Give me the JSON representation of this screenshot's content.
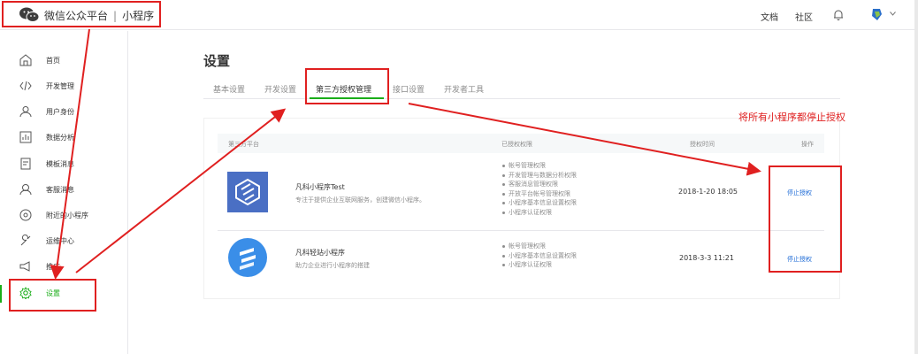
{
  "header": {
    "brand": "微信公众平台",
    "separator": "|",
    "product": "小程序",
    "links": [
      "文档",
      "社区"
    ],
    "icons": {
      "logo": "wechat-logo-icon",
      "bell": "bell-icon",
      "avatar": "avatar",
      "caret": "chevron-down-icon"
    }
  },
  "sidebar": {
    "items": [
      {
        "label": "首页",
        "icon": "home-icon"
      },
      {
        "label": "开发管理",
        "icon": "code-icon"
      },
      {
        "label": "用户身份",
        "icon": "user-icon"
      },
      {
        "label": "数据分析",
        "icon": "chart-icon"
      },
      {
        "label": "模板消息",
        "icon": "template-icon"
      },
      {
        "label": "客服消息",
        "icon": "service-icon"
      },
      {
        "label": "附近的小程序",
        "icon": "location-icon"
      },
      {
        "label": "运维中心",
        "icon": "wrench-icon"
      },
      {
        "label": "推广",
        "icon": "megaphone-icon"
      },
      {
        "label": "设置",
        "icon": "gear-icon",
        "active": true
      }
    ]
  },
  "main": {
    "title": "设置",
    "tabs": [
      "基本设置",
      "开发设置",
      "第三方授权管理",
      "接口设置",
      "开发者工具"
    ],
    "active_tab": "第三方授权管理",
    "table": {
      "headers": [
        "第三方平台",
        "已授权权限",
        "授权时间",
        "操作"
      ],
      "rows": [
        {
          "name": "凡科小程序Test",
          "desc": "专注于提供企业互联网服务，创建微信小程序。",
          "logo_color": "#4a6fc4",
          "permissions": [
            "帐号管理权限",
            "开发管理与数据分析权限",
            "客服消息管理权限",
            "开放平台帐号管理权限",
            "小程序基本信息设置权限",
            "小程序认证权限"
          ],
          "time": "2018-1-20 18:05",
          "action": "停止授权"
        },
        {
          "name": "凡科轻站小程序",
          "desc": "助力企业进行小程序的搭建",
          "logo_color": "#3a8ee8",
          "permissions": [
            "帐号管理权限",
            "小程序基本信息设置权限",
            "小程序认证权限"
          ],
          "time": "2018-3-3 11:21",
          "action": "停止授权"
        }
      ]
    }
  },
  "annotation": {
    "note": "将所有小程序都停止授权",
    "color": "#e02020"
  },
  "colors": {
    "accent": "#1aad19",
    "link": "#1e6bd6"
  }
}
